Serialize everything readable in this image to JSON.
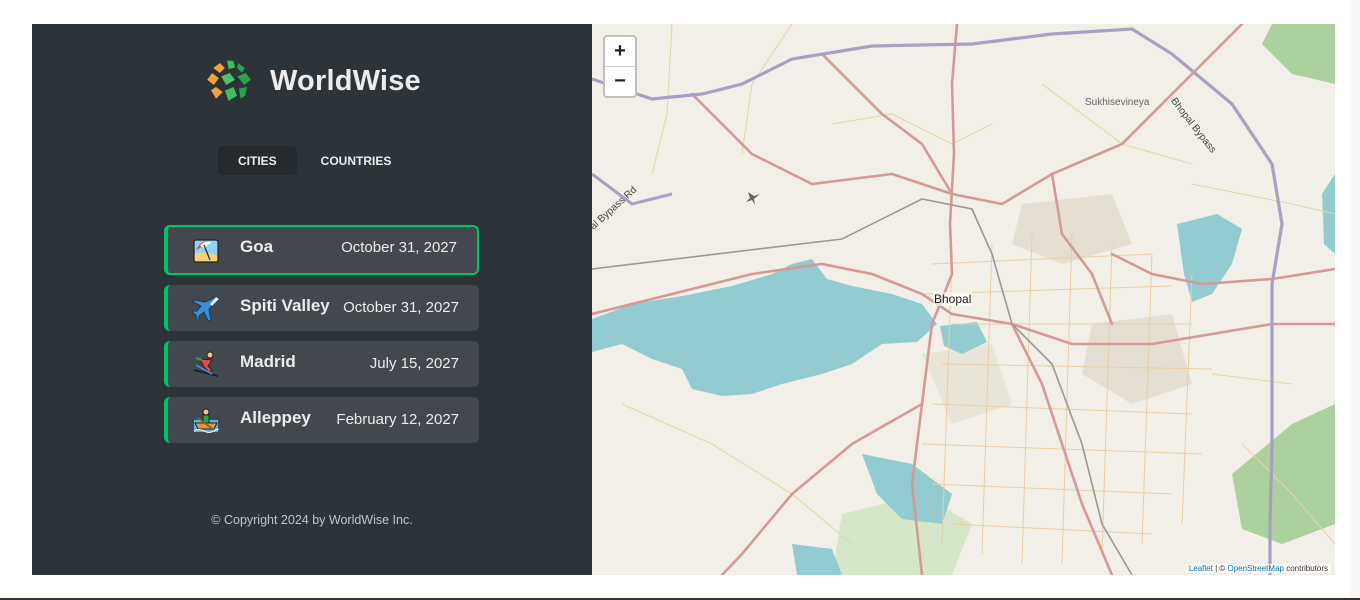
{
  "app": {
    "name": "WorldWise"
  },
  "tabs": [
    {
      "label": "CITIES",
      "active": true
    },
    {
      "label": "COUNTRIES",
      "active": false
    }
  ],
  "cities": [
    {
      "name": "Goa",
      "date": "October 31, 2027",
      "icon": "beach-umbrella-icon",
      "active": true
    },
    {
      "name": "Spiti Valley",
      "date": "October 31, 2027",
      "icon": "airplane-icon",
      "active": false
    },
    {
      "name": "Madrid",
      "date": "July 15, 2027",
      "icon": "skier-icon",
      "active": false
    },
    {
      "name": "Alleppey",
      "date": "February 12, 2027",
      "icon": "rowboat-icon",
      "active": false
    }
  ],
  "footer": {
    "copyright": "© Copyright 2024 by WorldWise Inc."
  },
  "map": {
    "zoom_in": "+",
    "zoom_out": "−",
    "labels": {
      "city": "Bhopal",
      "suburb": "Sukhisevineya",
      "road_right": "Bhopal Bypass",
      "road_left": "al Bypass Rd"
    },
    "attribution": {
      "leaflet": "Leaflet",
      "sep": " | © ",
      "osm": "OpenStreetMap",
      "suffix": " contributors"
    }
  },
  "colors": {
    "sidebar": "#2d3439",
    "accent": "#00c46a",
    "card": "#42484d",
    "water": "#92ccd0",
    "road": "#d69a96"
  }
}
